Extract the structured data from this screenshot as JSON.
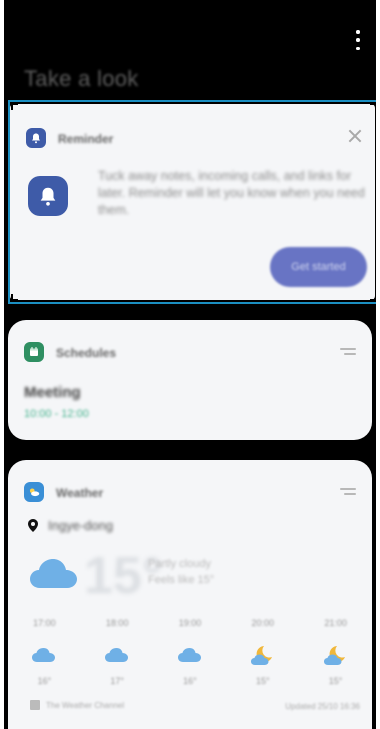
{
  "screen": {
    "title": "Take a look"
  },
  "reminder": {
    "title": "Reminder",
    "description": "Tuck away notes, incoming calls, and links for later. Reminder will let you know when you need them.",
    "button_label": "Get started"
  },
  "schedules": {
    "title": "Schedules",
    "event_title": "Meeting",
    "event_time": "10:00 - 12:00"
  },
  "weather": {
    "title": "Weather",
    "location": "Ingye-dong",
    "temperature": "15°",
    "condition": "Partly cloudy",
    "high_low": "Feels like 15°",
    "forecast": [
      {
        "time": "17:00",
        "icon": "cloud-icon",
        "temp": "16°"
      },
      {
        "time": "18:00",
        "icon": "cloud-icon",
        "temp": "17°"
      },
      {
        "time": "19:00",
        "icon": "cloud-icon",
        "temp": "16°"
      },
      {
        "time": "20:00",
        "icon": "moon-cloud-icon",
        "temp": "15°"
      },
      {
        "time": "21:00",
        "icon": "moon-cloud-icon",
        "temp": "15°"
      }
    ],
    "source": "The Weather Channel",
    "updated": "Updated 25/10 16:36"
  },
  "colors": {
    "accent_blue": "#3e5ba8",
    "button": "#6874c4",
    "schedule_green": "#2f8f62",
    "time_green": "#44b38d",
    "selection_frame": "#1b8fc2",
    "card_bg": "#f5f6f8"
  }
}
